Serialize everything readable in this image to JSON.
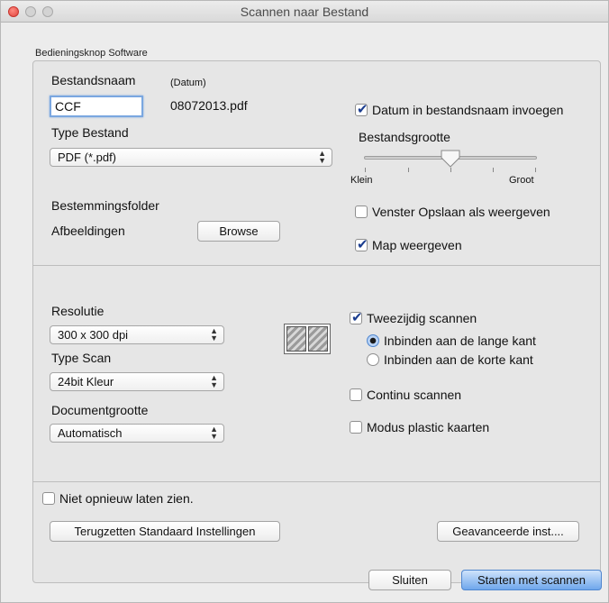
{
  "window": {
    "title": "Scannen naar Bestand"
  },
  "group": {
    "label": "Bedieningsknop Software"
  },
  "file": {
    "name_label": "Bestandsnaam",
    "date_note": "(Datum)",
    "name_value": "CCF",
    "date_value": "08072013.pdf",
    "insert_date_label": "Datum in bestandsnaam invoegen",
    "insert_date_checked": true,
    "type_label": "Type Bestand",
    "type_value": "PDF (*.pdf)",
    "size_label": "Bestandsgrootte",
    "size_min_label": "Klein",
    "size_max_label": "Groot",
    "size_level": 0.5
  },
  "destination": {
    "label": "Bestemmingsfolder",
    "folder": "Afbeeldingen",
    "browse_label": "Browse",
    "show_save_as_label": "Venster Opslaan als weergeven",
    "show_save_as_checked": false,
    "show_folder_label": "Map weergeven",
    "show_folder_checked": true
  },
  "scan": {
    "resolution_label": "Resolutie",
    "resolution_value": "300 x 300 dpi",
    "scan_type_label": "Type Scan",
    "scan_type_value": "24bit Kleur",
    "doc_size_label": "Documentgrootte",
    "doc_size_value": "Automatisch",
    "duplex_label": "Tweezijdig scannen",
    "duplex_checked": true,
    "bind_long_label": "Inbinden aan de lange kant",
    "bind_short_label": "Inbinden aan de korte kant",
    "binding_selected": "long",
    "continuous_label": "Continu scannen",
    "continuous_checked": false,
    "plastic_label": "Modus plastic kaarten",
    "plastic_checked": false
  },
  "footer": {
    "dont_show_label": "Niet opnieuw laten zien.",
    "dont_show_checked": false,
    "reset_label": "Terugzetten Standaard Instellingen",
    "advanced_label": "Geavanceerde inst....",
    "close_label": "Sluiten",
    "start_label": "Starten met scannen"
  },
  "icons": {
    "popup_arrows": "up-down-arrows-icon",
    "duplex": "duplex-scan-icon"
  }
}
